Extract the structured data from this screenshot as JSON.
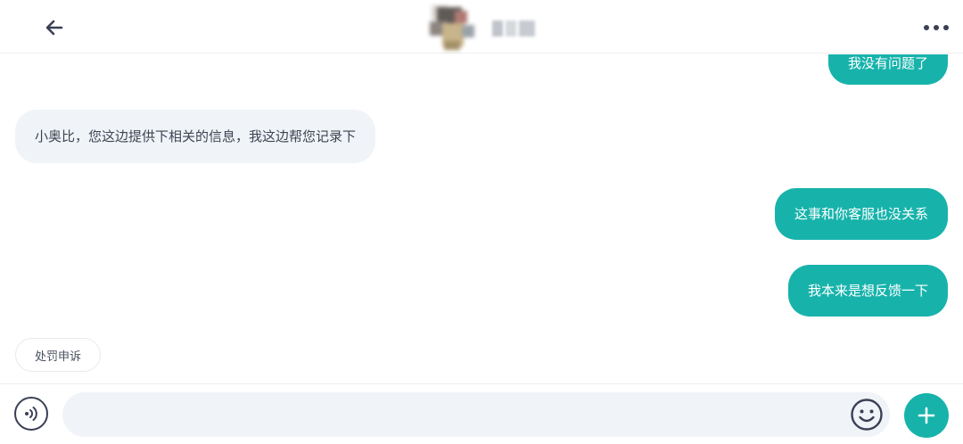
{
  "header": {
    "back_icon": "arrow-left-icon",
    "more_icon": "more-horizontal-icon",
    "contact_avatar": "blurred-avatar",
    "contact_name": ""
  },
  "messages": [
    {
      "direction": "outgoing",
      "text": "我没有问题了"
    },
    {
      "direction": "incoming",
      "text": "小奥比，您这边提供下相关的信息，我这边帮您记录下"
    },
    {
      "direction": "outgoing",
      "text": "这事和你客服也没关系"
    },
    {
      "direction": "outgoing",
      "text": "我本来是想反馈一下"
    }
  ],
  "quick_reply": {
    "label": "处罚申诉"
  },
  "input_bar": {
    "voice_icon": "voice-wave-icon",
    "placeholder": "",
    "value": "",
    "emoji_icon": "smile-icon",
    "plus_icon": "plus-icon"
  },
  "colors": {
    "accent": "#17b3ab",
    "incoming_bubble": "#f0f3f7",
    "incoming_text": "#3d4452",
    "icon_dark": "#3a3f55"
  }
}
